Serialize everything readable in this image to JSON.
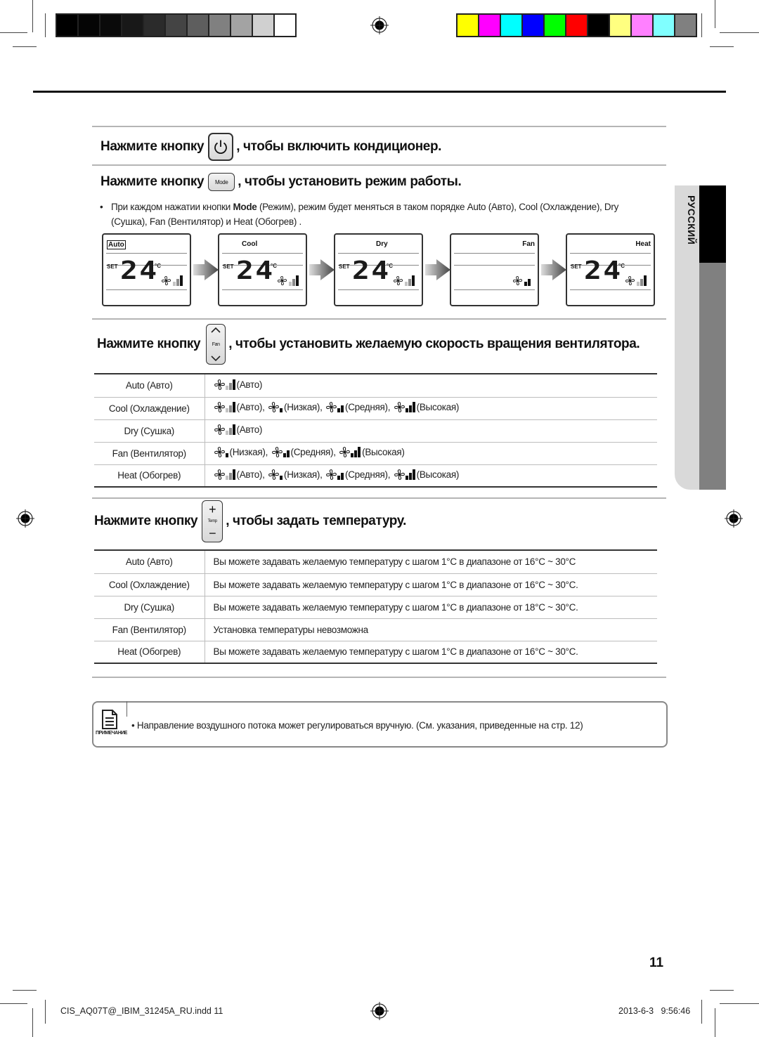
{
  "color_bars": {
    "grayscale": [
      "#000000",
      "#050505",
      "#0a0a0a",
      "#181818",
      "#2b2b2b",
      "#444444",
      "#5e5e5e",
      "#808080",
      "#a3a3a3",
      "#d0d0d0",
      "#ffffff"
    ],
    "process": [
      "#ffff00",
      "#ff00ff",
      "#00ffff",
      "#0000ff",
      "#00ff00",
      "#ff0000",
      "#000000",
      "#ffff80",
      "#ff80ff",
      "#80ffff",
      "#808080"
    ]
  },
  "language_tab": "РУССКИЙ",
  "power_section": {
    "prefix": "Нажмите кнопку",
    "button_icon": "power-icon",
    "suffix": ", чтобы включить кондиционер."
  },
  "mode_section": {
    "prefix": "Нажмите кнопку",
    "button_label": "Mode",
    "suffix": ", чтобы установить режим работы.",
    "bullet": {
      "pre": "При каждом нажатии кнопки ",
      "bold": "Mode",
      "post": " (Режим), режим будет меняться в таком порядке Auto (Авто), Cool (Охлаждение), Dry (Сушка), Fan (Вентилятор) и Heat (Обогрев) ."
    },
    "displays": [
      {
        "mode": "Auto",
        "set_label": "SET",
        "temp": "24",
        "unit": "°C",
        "show_temp": true,
        "fan_bars": "auto"
      },
      {
        "mode": "Cool",
        "set_label": "SET",
        "temp": "24",
        "unit": "°C",
        "show_temp": true,
        "fan_bars": "auto"
      },
      {
        "mode": "Dry",
        "set_label": "SET",
        "temp": "24",
        "unit": "°C",
        "show_temp": true,
        "fan_bars": "auto"
      },
      {
        "mode": "Fan",
        "set_label": "",
        "temp": "",
        "unit": "",
        "show_temp": false,
        "fan_bars": "medium"
      },
      {
        "mode": "Heat",
        "set_label": "SET",
        "temp": "24",
        "unit": "°C",
        "show_temp": true,
        "fan_bars": "auto"
      }
    ]
  },
  "fan_section": {
    "prefix": "Нажмите кнопку",
    "button_label": "Fan",
    "suffix": ", чтобы установить желаемую скорость вращения вентилятора.",
    "rows": [
      {
        "mode": "Auto (Авто)",
        "speeds": [
          {
            "level": "auto",
            "label": "(Авто)"
          }
        ]
      },
      {
        "mode": "Cool (Охлаждение)",
        "speeds": [
          {
            "level": "auto",
            "label": "(Авто),"
          },
          {
            "level": "low",
            "label": "(Низкая),"
          },
          {
            "level": "medium",
            "label": "(Средняя),"
          },
          {
            "level": "high",
            "label": "(Высокая)"
          }
        ]
      },
      {
        "mode": "Dry (Сушка)",
        "speeds": [
          {
            "level": "auto",
            "label": "(Авто)"
          }
        ]
      },
      {
        "mode": "Fan (Вентилятор)",
        "speeds": [
          {
            "level": "low",
            "label": "(Низкая),"
          },
          {
            "level": "medium",
            "label": "(Средняя),"
          },
          {
            "level": "high",
            "label": "(Высокая)"
          }
        ]
      },
      {
        "mode": "Heat (Обогрев)",
        "speeds": [
          {
            "level": "auto",
            "label": "(Авто),"
          },
          {
            "level": "low",
            "label": "(Низкая),"
          },
          {
            "level": "medium",
            "label": "(Средняя),"
          },
          {
            "level": "high",
            "label": "(Высокая)"
          }
        ]
      }
    ]
  },
  "temp_section": {
    "prefix": "Нажмите кнопку",
    "button_label": "Temp",
    "suffix": ", чтобы задать температуру.",
    "rows": [
      {
        "mode": "Auto (Авто)",
        "text": "Вы можете задавать желаемую температуру с шагом 1°C в диапазоне от 16°C ~ 30°C"
      },
      {
        "mode": "Cool (Охлаждение)",
        "text": "Вы можете задавать желаемую температуру с шагом 1°C в диапазоне от 16°C ~ 30°C."
      },
      {
        "mode": "Dry (Сушка)",
        "text": "Вы можете задавать желаемую температуру с шагом 1°C в диапазоне от 18°C ~ 30°C."
      },
      {
        "mode": "Fan (Вентилятор)",
        "text": "Установка температуры невозможна"
      },
      {
        "mode": "Heat (Обогрев)",
        "text": "Вы можете задавать желаемую температуру с шагом 1°C в диапазоне от 16°C ~ 30°C."
      }
    ]
  },
  "note": {
    "label": "ПРИМЕЧАНИЕ",
    "text": "•  Направление воздушного потока может регулироваться вручную. (См. указания, приведенные на стр. 12)"
  },
  "page_number": "11",
  "footer": {
    "file": "CIS_AQ07T@_IBIM_31245A_RU.indd   11",
    "timestamp": "2013-6-3   9:56:46"
  }
}
